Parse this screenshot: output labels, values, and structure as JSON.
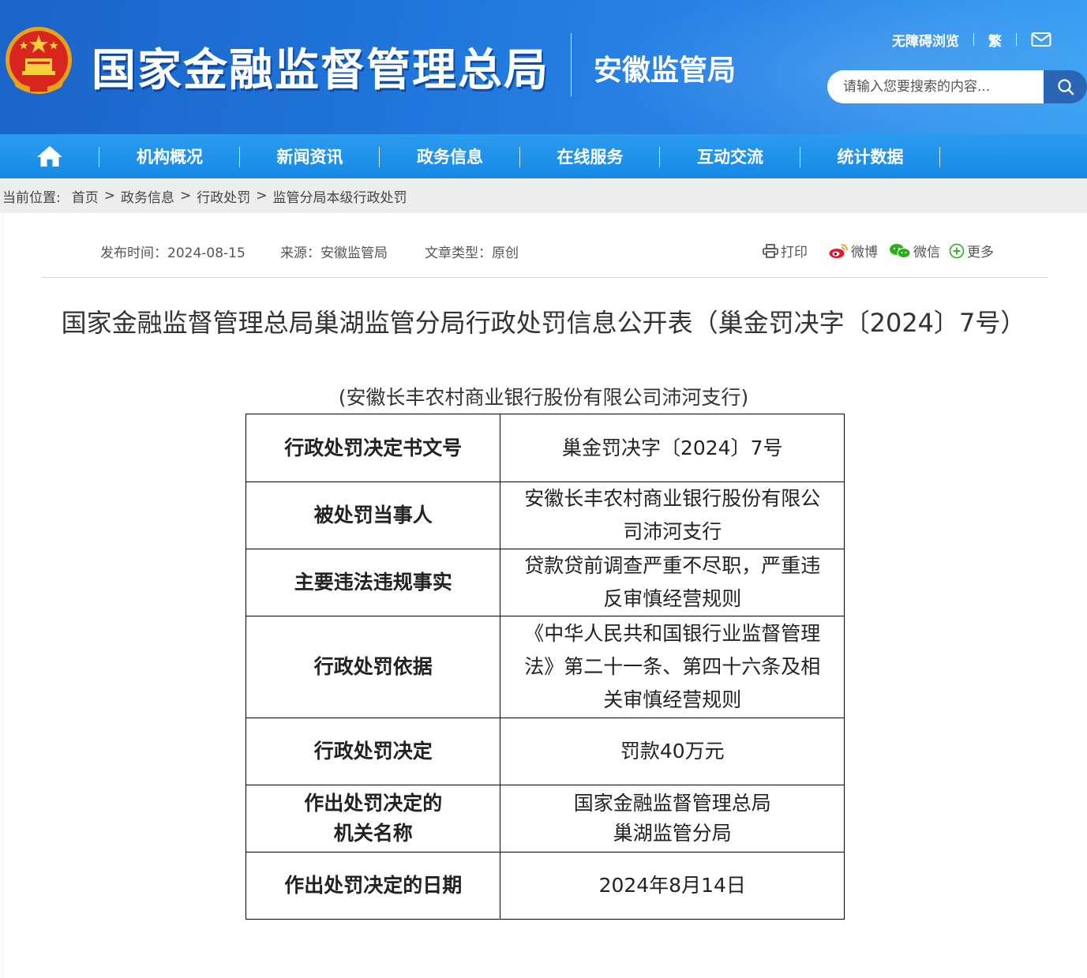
{
  "header": {
    "site_title": "国家金融监督管理总局",
    "sub_title": "安徽监管局",
    "links": {
      "accessible": "无障碍浏览",
      "traditional": "繁"
    },
    "search": {
      "placeholder": "请输入您要搜索的内容..."
    }
  },
  "nav": {
    "items": [
      {
        "label": "机构概况"
      },
      {
        "label": "新闻资讯"
      },
      {
        "label": "政务信息"
      },
      {
        "label": "在线服务"
      },
      {
        "label": "互动交流"
      },
      {
        "label": "统计数据"
      }
    ]
  },
  "breadcrumb": {
    "prefix": "当前位置:",
    "items": [
      "首页",
      "政务信息",
      "行政处罚",
      "监管分局本级行政处罚"
    ]
  },
  "meta": {
    "publish": "发布时间：2024-08-15",
    "source": "来源：安徽监管局",
    "type": "文章类型：原创"
  },
  "share": {
    "print": "打印",
    "weibo": "微博",
    "wechat": "微信",
    "more": "更多"
  },
  "article": {
    "title": "国家金融监督管理总局巢湖监管分局行政处罚信息公开表（巢金罚决字〔2024〕7号）",
    "subtitle": "(安徽长丰农村商业银行股份有限公司沛河支行)",
    "table": [
      {
        "key": "行政处罚决定书文号",
        "value": [
          "巢金罚决字〔2024〕7号"
        ]
      },
      {
        "key": "被处罚当事人",
        "value": [
          "安徽长丰农村商业银行股份有限公",
          "司沛河支行"
        ]
      },
      {
        "key": "主要违法违规事实",
        "value": [
          "贷款贷前调查严重不尽职，严重违",
          "反审慎经营规则"
        ]
      },
      {
        "key": "行政处罚依据",
        "value": [
          "《中华人民共和国银行业监督管理",
          "法》第二十一条、第四十六条及相",
          "关审慎经营规则"
        ]
      },
      {
        "key": "行政处罚决定",
        "value": [
          "罚款40万元"
        ]
      },
      {
        "key": "作出处罚决定的机关名称",
        "key_lines": [
          "作出处罚决定的",
          "机关名称"
        ],
        "value": [
          "国家金融监督管理总局",
          "巢湖监管分局"
        ]
      },
      {
        "key": "作出处罚决定的日期",
        "value": [
          "2024年8月14日"
        ]
      }
    ]
  }
}
